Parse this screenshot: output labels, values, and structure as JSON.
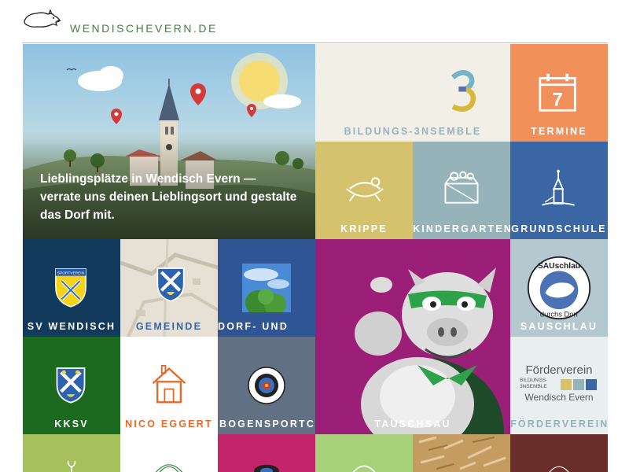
{
  "site": {
    "title": "WENDISCHEVERN.DE"
  },
  "hero": {
    "text": "Lieblingsplätze in Wendisch Evern — verrate uns deinen Lieblingsort und gestalte das Dorf mit."
  },
  "tiles": {
    "bildung": {
      "label": "BILDUNGS-3NSEMBLE",
      "numeral": "3"
    },
    "termine": {
      "label": "TERMINE",
      "day": "7"
    },
    "krippe": {
      "label": "KRIPPE"
    },
    "kindergarten": {
      "label": "KINDERGARTEN"
    },
    "grundschule": {
      "label": "GRUNDSCHULE"
    },
    "sv": {
      "label": "SV WENDISCH EVERN",
      "badge": "SPORTVEREIN"
    },
    "gemeinde": {
      "label": "GEMEINDE"
    },
    "dorf": {
      "label": "DORF- UND SCHULENTWICKLUNG"
    },
    "tauschsau": {
      "label": "TAUSCHSAU"
    },
    "sauschlau": {
      "label": "SAUSCHLAU DURCHS DORF",
      "logo_top": "SAUschlau",
      "logo_bottom": "durchs Dorf"
    },
    "kksv": {
      "label": "KKSV"
    },
    "nico": {
      "label": "NICO EGGERT"
    },
    "bogensport": {
      "label": "BOGENSPORTCLUB"
    },
    "foerderverein": {
      "label": "FÖRDERVEREIN",
      "logo_line1": "Förderverein",
      "logo_line2": "BILDUNGS-",
      "logo_line3": "3NSEMBLE",
      "logo_line4": "Wendisch Evern"
    }
  },
  "colors": {
    "title_green": "#4a7a48",
    "cream": "#f2efe7",
    "orange": "#f1905a",
    "mustard": "#d4c36c",
    "slate_blue": "#96b3ba",
    "deep_blue": "#3a67a4",
    "navy": "#123a5c",
    "map_beige": "#e6e1d4",
    "royal_blue": "#2f5595",
    "magenta": "#9b1f77",
    "pale_blue": "#b3c9cf",
    "forest": "#1c6a1f",
    "white": "#ffffff",
    "gray_blue": "#617083",
    "light_gray": "#e9eef0"
  }
}
